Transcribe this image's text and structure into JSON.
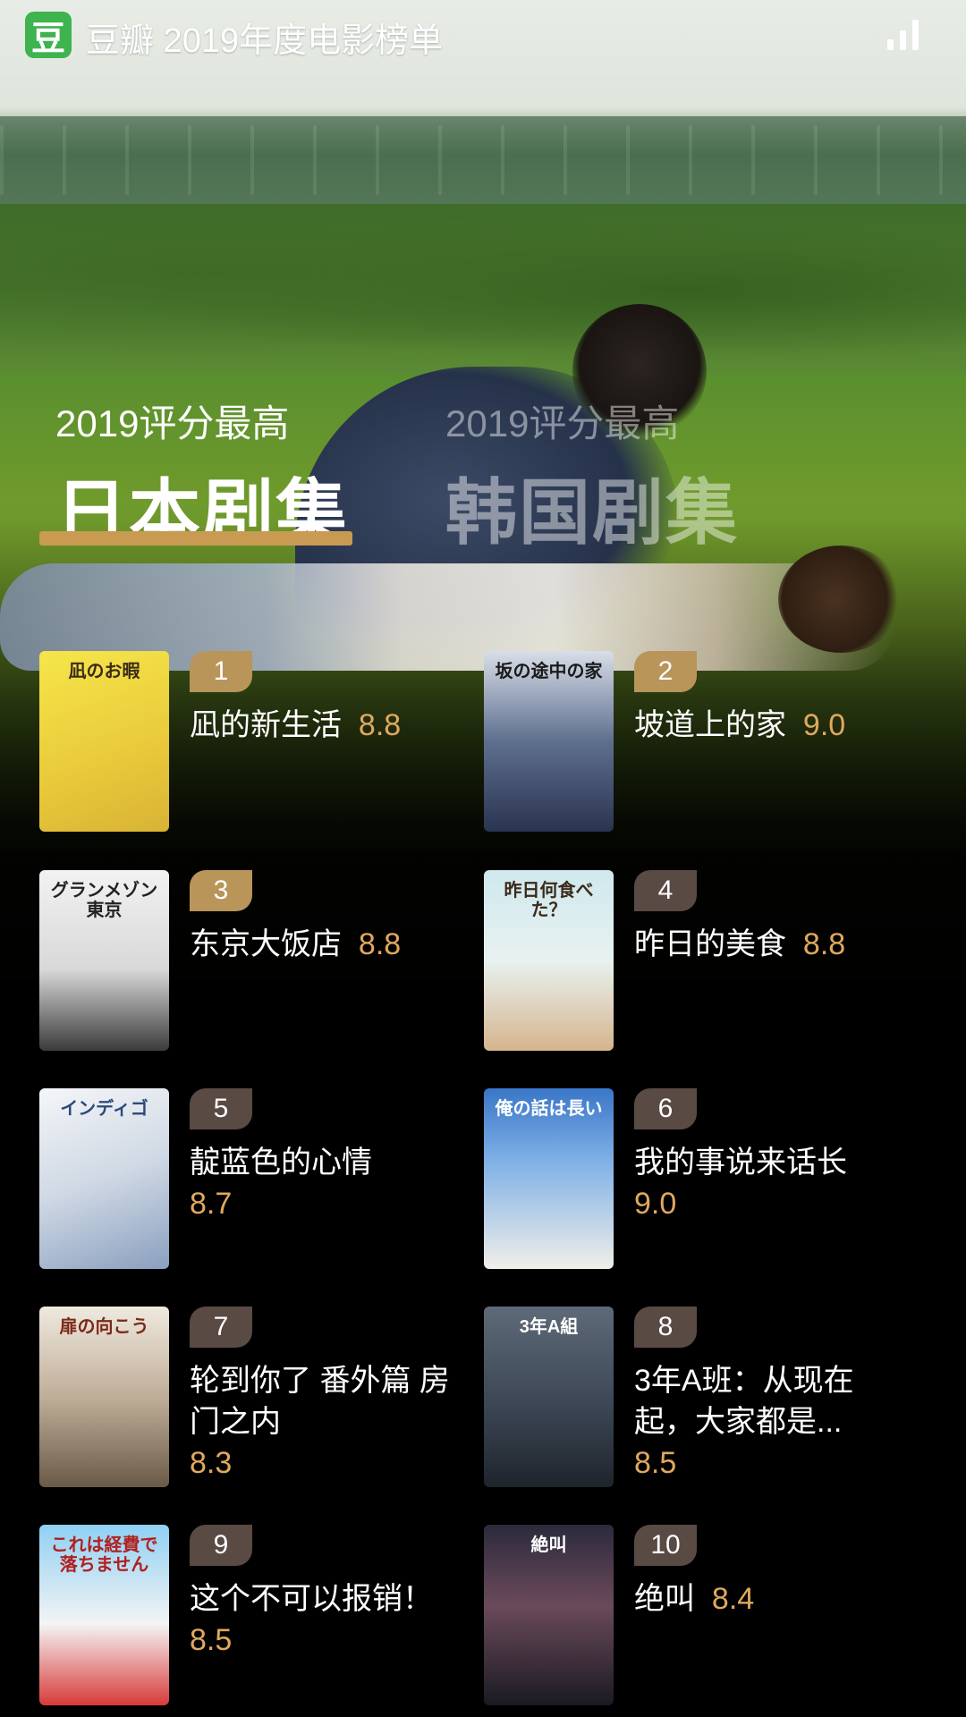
{
  "status_bar": {
    "app_logo": "豆",
    "title": "豆瓣 2019年度电影榜单"
  },
  "tabs": [
    {
      "sub": "2019评分最高",
      "main": "日本剧集",
      "active": true
    },
    {
      "sub": "2019评分最高",
      "main": "韩国剧集",
      "active": false
    }
  ],
  "items": [
    {
      "rank": "1",
      "title": "凪的新生活",
      "score": "8.8",
      "poster_text": "凪のお暇"
    },
    {
      "rank": "2",
      "title": "坡道上的家",
      "score": "9.0",
      "poster_text": "坂の途中の家"
    },
    {
      "rank": "3",
      "title": "东京大饭店",
      "score": "8.8",
      "poster_text": "グランメゾン東京"
    },
    {
      "rank": "4",
      "title": "昨日的美食",
      "score": "8.8",
      "poster_text": "昨日何食べた？"
    },
    {
      "rank": "5",
      "title": "靛蓝色的心情",
      "score": "8.7",
      "poster_text": "インディゴ"
    },
    {
      "rank": "6",
      "title": "我的事说来话长",
      "score": "9.0",
      "poster_text": "俺の話は長い"
    },
    {
      "rank": "7",
      "title": "轮到你了 番外篇 房门之内",
      "score": "8.3",
      "poster_text": "扉の向こう"
    },
    {
      "rank": "8",
      "title": "3年A班：从现在起，大家都是...",
      "score": "8.5",
      "poster_text": "3年A組"
    },
    {
      "rank": "9",
      "title": "这个不可以报销！",
      "score": "8.5",
      "poster_text": "これは経費で落ちません"
    },
    {
      "rank": "10",
      "title": "绝叫",
      "score": "8.4",
      "poster_text": "絶叫"
    }
  ]
}
